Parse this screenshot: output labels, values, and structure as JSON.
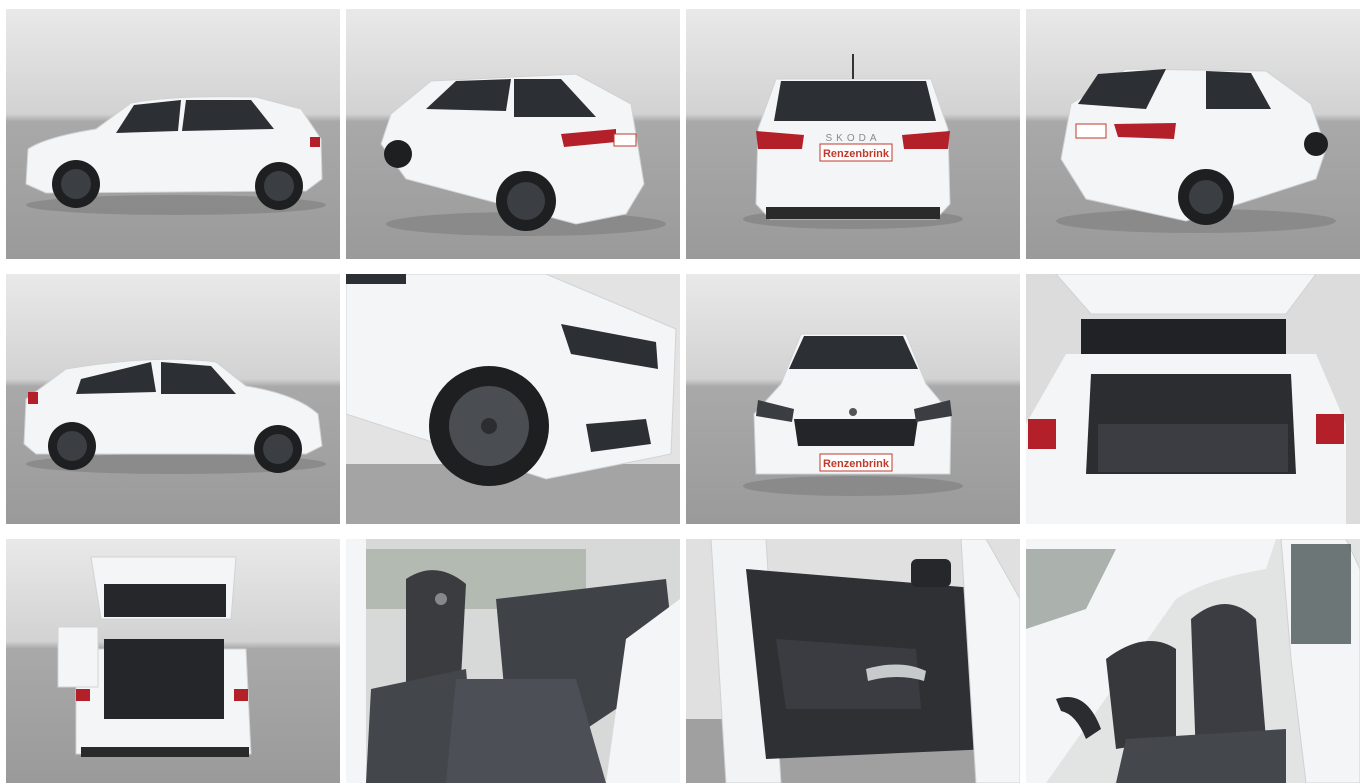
{
  "gallery": {
    "dealer_plate": "Renzenbrink",
    "brand_badge": "SKODA",
    "photos": [
      {
        "view": "side-left"
      },
      {
        "view": "rear-three-quarter-left"
      },
      {
        "view": "rear"
      },
      {
        "view": "rear-three-quarter-right"
      },
      {
        "view": "side-right"
      },
      {
        "view": "front-wheel-detail"
      },
      {
        "view": "front"
      },
      {
        "view": "trunk-open"
      },
      {
        "view": "tailgate-open-full"
      },
      {
        "view": "rear-seats"
      },
      {
        "view": "door-panel"
      },
      {
        "view": "front-seats"
      }
    ]
  },
  "colors": {
    "car_body": "#f4f5f6",
    "glass": "#2c2f33",
    "tire": "#1e1f21",
    "rim": "#3b3e42",
    "tail_light": "#b3202a",
    "ground": "#9c9c9c",
    "sky": "#e6e6e6",
    "upholstery": "#3a3c40"
  }
}
